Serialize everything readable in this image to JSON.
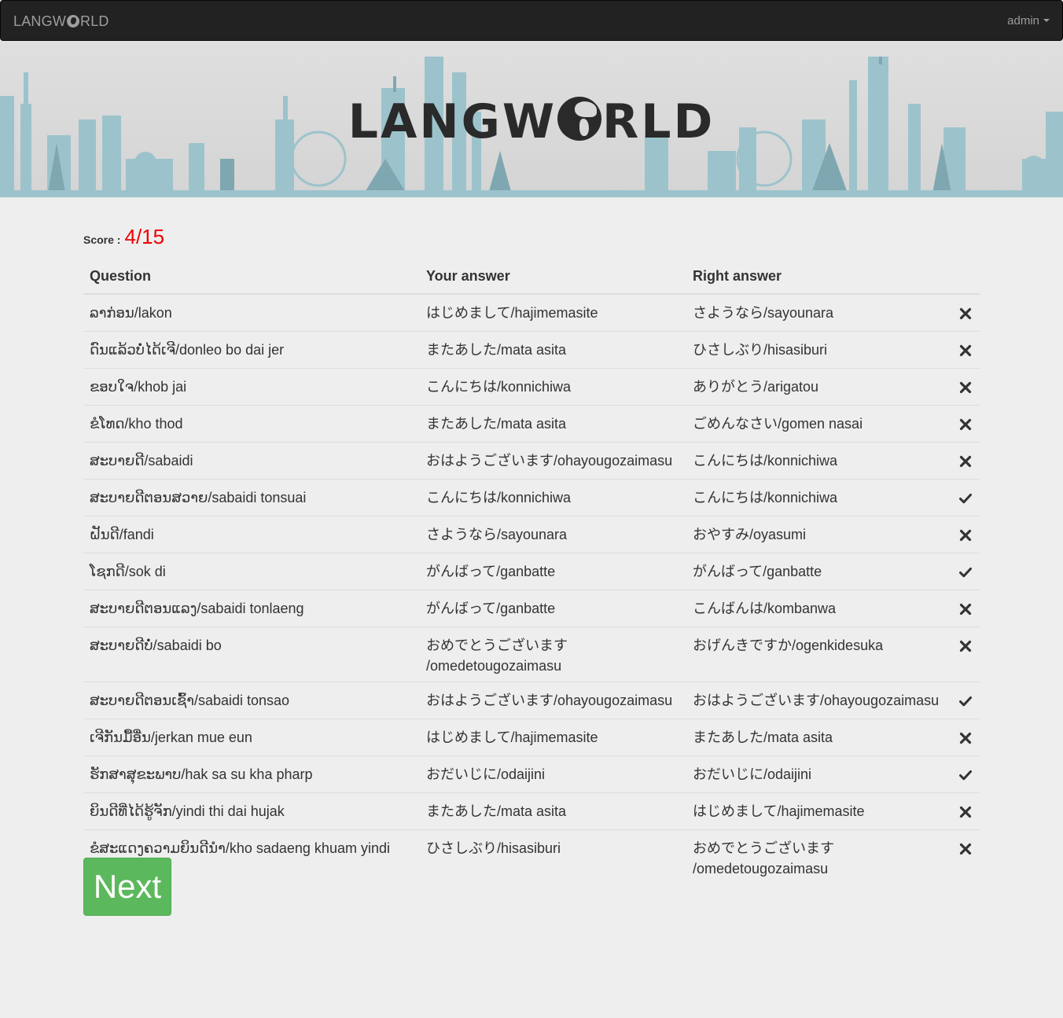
{
  "navbar": {
    "brand_prefix": "LANGW",
    "brand_suffix": "RLD",
    "user": "admin"
  },
  "banner": {
    "logo_prefix": "LANGW",
    "logo_suffix": "RLD"
  },
  "score": {
    "label": "Score :",
    "value": "4/15"
  },
  "table": {
    "headers": [
      "Question",
      "Your answer",
      "Right answer"
    ],
    "rows": [
      {
        "question": "ລາກ່ອນ/lakon",
        "your_answer": "はじめまして/hajimemasite",
        "right_answer": "さようなら/sayounara",
        "result": "wrong"
      },
      {
        "question": "ດົນແລ້ວບໍ່ໄດ້ເຈີ/donleo bo dai jer",
        "your_answer": "またあした/mata asita",
        "right_answer": "ひさしぶり/hisasiburi",
        "result": "wrong"
      },
      {
        "question": "ຂອບໃຈ/khob jai",
        "your_answer": "こんにちは/konnichiwa",
        "right_answer": "ありがとう/arigatou",
        "result": "wrong"
      },
      {
        "question": "ຂໍໂທດ/kho thod",
        "your_answer": "またあした/mata asita",
        "right_answer": "ごめんなさい/gomen nasai",
        "result": "wrong"
      },
      {
        "question": "ສະບາຍດີ/sabaidi",
        "your_answer": "おはようございます/ohayougozaimasu",
        "right_answer": "こんにちは/konnichiwa",
        "result": "wrong"
      },
      {
        "question": "ສະບາຍດີຕອນສວາຍ/sabaidi tonsuai",
        "your_answer": "こんにちは/konnichiwa",
        "right_answer": "こんにちは/konnichiwa",
        "result": "right"
      },
      {
        "question": "ຝັນດີ/fandi",
        "your_answer": "さようなら/sayounara",
        "right_answer": "おやすみ/oyasumi",
        "result": "wrong"
      },
      {
        "question": "ໂຊກດີ/sok di",
        "your_answer": "がんばって/ganbatte",
        "right_answer": "がんばって/ganbatte",
        "result": "right"
      },
      {
        "question": "ສະບາຍດີຕອນແລງ/sabaidi tonlaeng",
        "your_answer": "がんばって/ganbatte",
        "right_answer": "こんばんは/kombanwa",
        "result": "wrong"
      },
      {
        "question": "ສະບາຍດີບໍ່/sabaidi bo",
        "your_answer": "おめでとうございます /omedetougozaimasu",
        "right_answer": "おげんきですか/ogenkidesuka",
        "result": "wrong"
      },
      {
        "question": "ສະບາຍດີຕອນເຊົ້າ/sabaidi tonsao",
        "your_answer": "おはようございます/ohayougozaimasu",
        "right_answer": "おはようございます/ohayougozaimasu",
        "result": "right"
      },
      {
        "question": "ເຈີກັນມື້ອື່ນ/jerkan mue eun",
        "your_answer": "はじめまして/hajimemasite",
        "right_answer": "またあした/mata asita",
        "result": "wrong"
      },
      {
        "question": "ຮັກສາສຸຂະພາບ/hak sa su kha pharp",
        "your_answer": "おだいじに/odaijini",
        "right_answer": "おだいじに/odaijini",
        "result": "right"
      },
      {
        "question": "ຍິນດີທີ່ໄດ້ຮູ້ຈັກ/yindi thi dai hujak",
        "your_answer": "またあした/mata asita",
        "right_answer": "はじめまして/hajimemasite",
        "result": "wrong"
      },
      {
        "question": "ຂໍສະແດງຄວາມຍິນດີນຳ/kho sadaeng khuam yindi nam",
        "your_answer": "ひさしぶり/hisasiburi",
        "right_answer": "おめでとうございます /omedetougozaimasu",
        "result": "wrong"
      }
    ]
  },
  "icons": {
    "right": "check-icon",
    "wrong": "cross-icon"
  },
  "next_button": {
    "label": "Next",
    "color": "#5cb85c"
  },
  "colors": {
    "navbar_bg": "#222222",
    "score_value": "#ee0000",
    "skyline": "#7fb2bf"
  }
}
